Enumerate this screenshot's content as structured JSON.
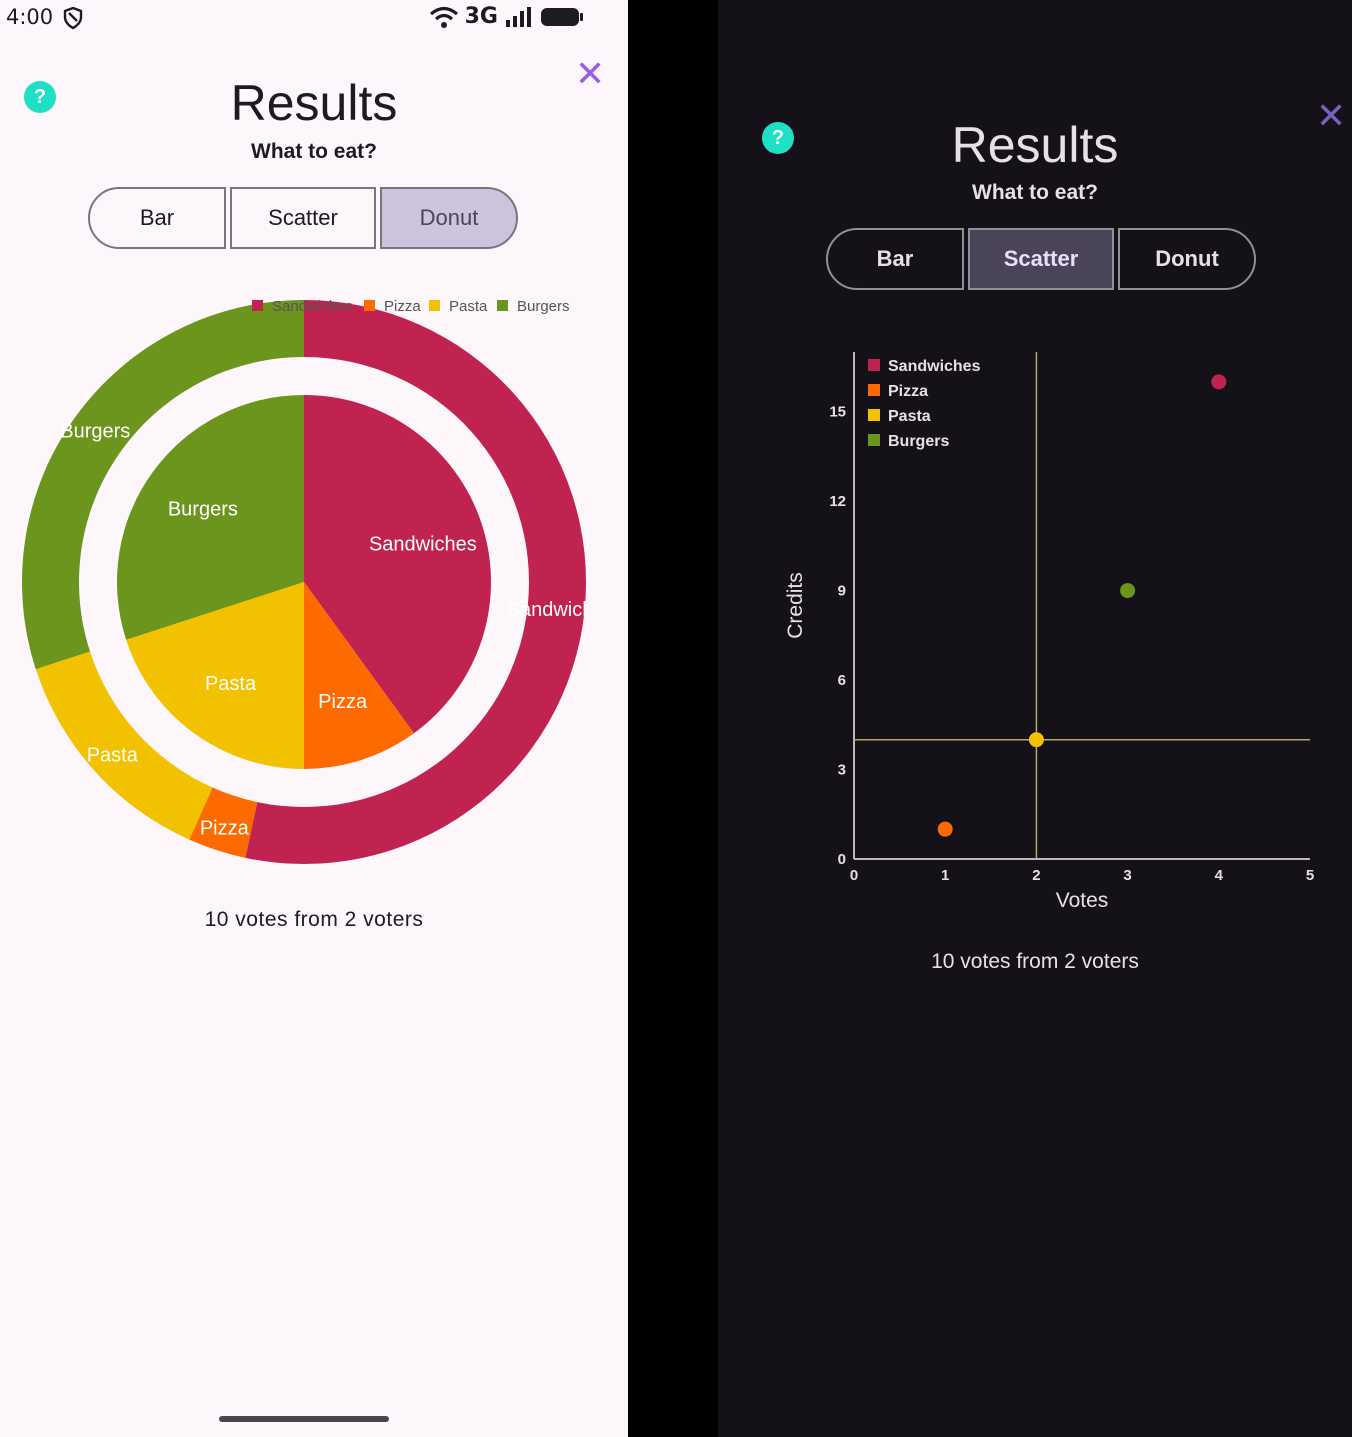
{
  "status_bar": {
    "time": "4:00",
    "network": "3G"
  },
  "light_panel": {
    "title": "Results",
    "subtitle": "What to eat?",
    "help_label": "?",
    "close_label": "✕",
    "tabs": [
      {
        "label": "Bar",
        "selected": false
      },
      {
        "label": "Scatter",
        "selected": false
      },
      {
        "label": "Donut",
        "selected": true
      }
    ],
    "summary": "10 votes from 2 voters"
  },
  "dark_panel": {
    "title": "Results",
    "subtitle": "What to eat?",
    "help_label": "?",
    "close_label": "✕",
    "tabs": [
      {
        "label": "Bar",
        "selected": false
      },
      {
        "label": "Scatter",
        "selected": true
      },
      {
        "label": "Donut",
        "selected": false
      }
    ],
    "summary": "10 votes from 2 voters"
  },
  "colors": {
    "sandwiches": "#c0234f",
    "pizza": "#fc6a00",
    "pasta": "#f2c200",
    "burgers": "#6b951d",
    "help_badge": "#1de0c4",
    "close_light": "#9a5be8",
    "close_dark": "#7c5fbf"
  },
  "chart_data": [
    {
      "type": "pie",
      "variant": "donut-nested",
      "legend": [
        "Sandwiches",
        "Pizza",
        "Pasta",
        "Burgers"
      ],
      "legend_position": "top-right",
      "inner_ring": {
        "labels": [
          "Sandwiches",
          "Pizza",
          "Pasta",
          "Burgers"
        ],
        "values": [
          4,
          1,
          2,
          3
        ]
      },
      "outer_ring": {
        "labels": [
          "Sandwiches",
          "Pizza",
          "Pasta",
          "Burgers"
        ],
        "values": [
          16,
          1,
          4,
          9
        ]
      }
    },
    {
      "type": "scatter",
      "xlabel": "Votes",
      "ylabel": "Credits",
      "xlim": [
        0,
        5
      ],
      "ylim": [
        0,
        17
      ],
      "xticks": [
        0,
        1,
        2,
        3,
        4,
        5
      ],
      "yticks": [
        0,
        3,
        6,
        9,
        12,
        15
      ],
      "legend_position": "top-left",
      "grid": false,
      "crosshair": {
        "x": 2,
        "y": 4
      },
      "series": [
        {
          "name": "Sandwiches",
          "x": [
            4
          ],
          "y": [
            16
          ]
        },
        {
          "name": "Pizza",
          "x": [
            1
          ],
          "y": [
            1
          ]
        },
        {
          "name": "Pasta",
          "x": [
            2
          ],
          "y": [
            4
          ]
        },
        {
          "name": "Burgers",
          "x": [
            3
          ],
          "y": [
            9
          ]
        }
      ]
    }
  ]
}
